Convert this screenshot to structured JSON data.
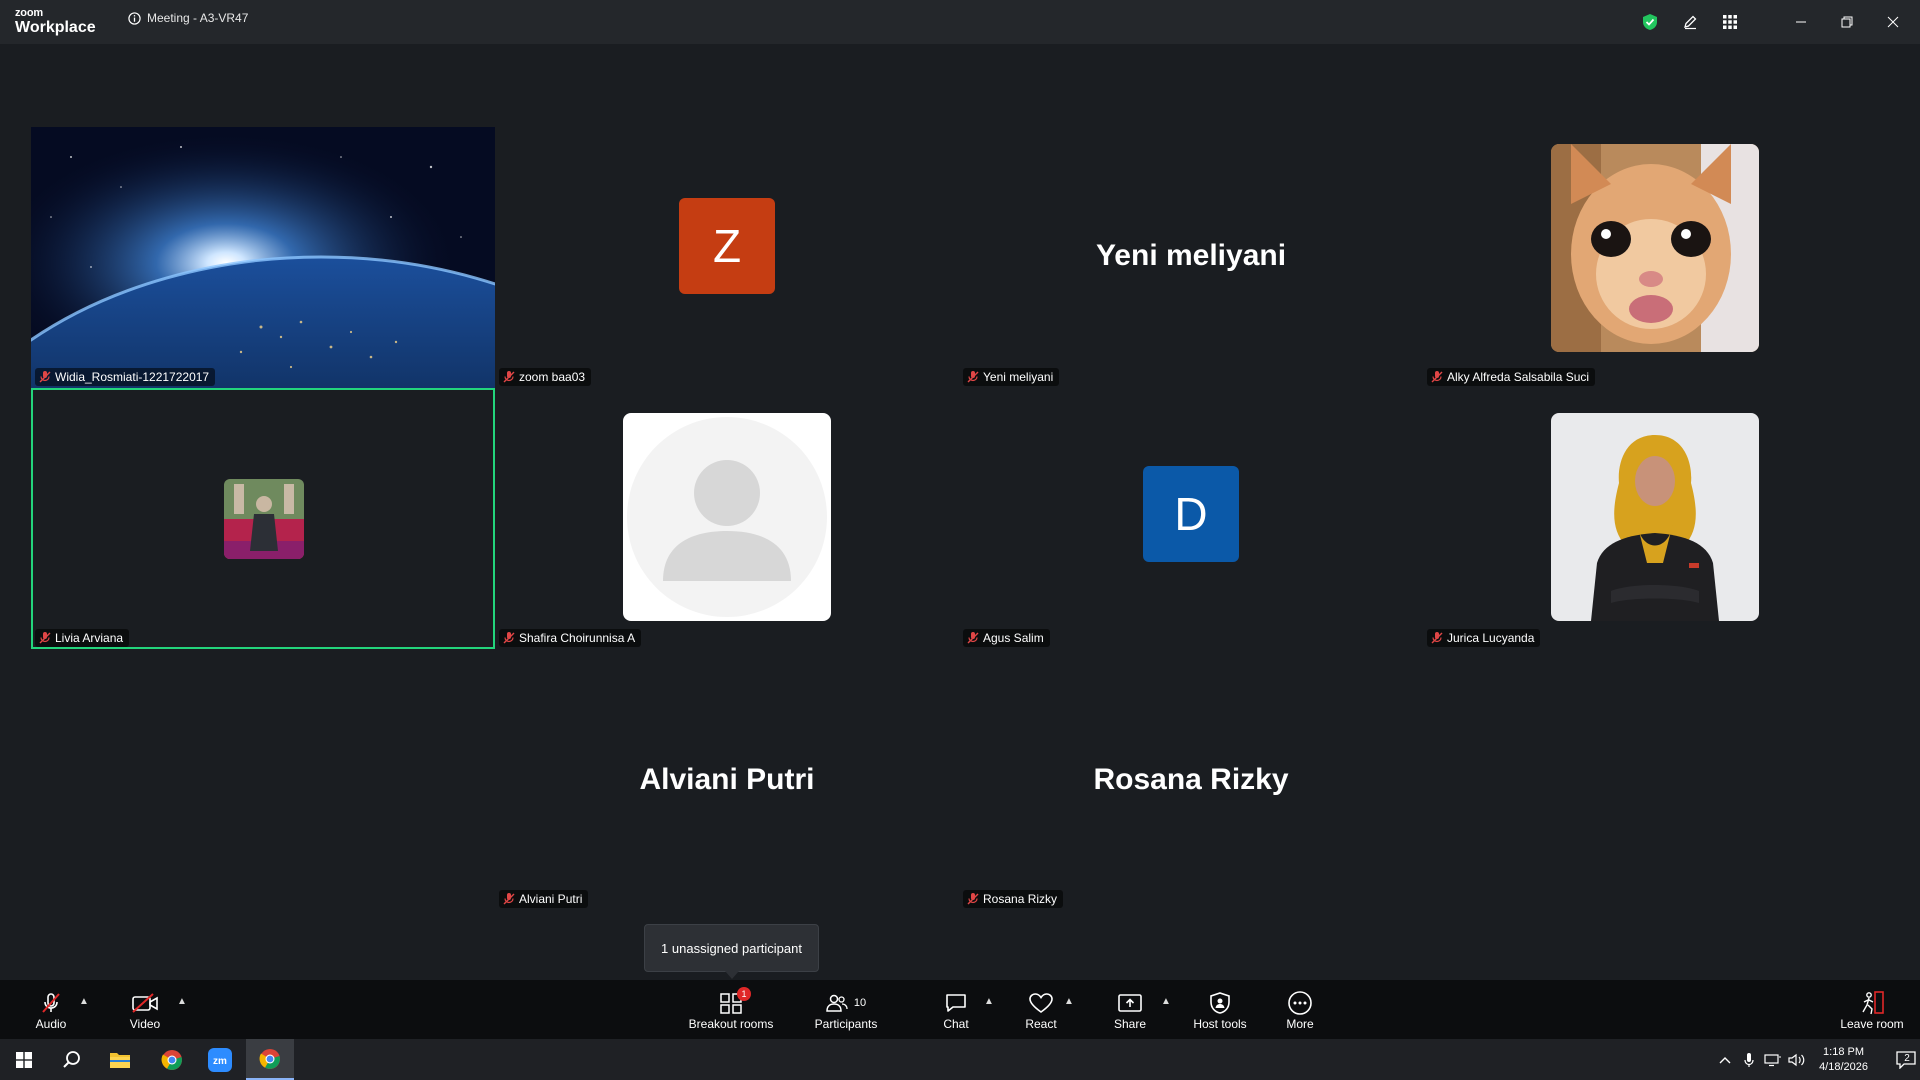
{
  "titlebar": {
    "brand_top": "zoom",
    "brand_bottom": "Workplace",
    "meeting_title": "Meeting - A3-VR47"
  },
  "tiles": [
    {
      "name": "Widia_Rosmiati-1221722017",
      "display": "video-earth"
    },
    {
      "name": "zoom baa03",
      "display": "initial",
      "initial": "Z",
      "color": "#c53d12"
    },
    {
      "name": "Yeni meliyani",
      "display": "text",
      "big_name": "Yeni meliyani"
    },
    {
      "name": "Alky Alfreda Salsabila Suci",
      "display": "photo-cat"
    },
    {
      "name": "Livia Arviana",
      "display": "small-photo",
      "active": true
    },
    {
      "name": "Shafira Choirunnisa A",
      "display": "default-avatar"
    },
    {
      "name": "Agus Salim",
      "display": "initial",
      "initial": "D",
      "color": "#0b59a8"
    },
    {
      "name": "Jurica Lucyanda",
      "display": "photo-person"
    },
    {
      "name": "Alviani Putri",
      "display": "text",
      "big_name": "Alviani Putri"
    },
    {
      "name": "Rosana Rizky",
      "display": "text",
      "big_name": "Rosana Rizky"
    }
  ],
  "tooltip": "1 unassigned participant",
  "toolbar": {
    "audio": "Audio",
    "video": "Video",
    "breakout": "Breakout rooms",
    "breakout_badge": "1",
    "participants": "Participants",
    "participants_count": "10",
    "chat": "Chat",
    "react": "React",
    "share": "Share",
    "host_tools": "Host tools",
    "more": "More",
    "leave": "Leave room"
  },
  "taskbar": {
    "time": "1:18 PM",
    "date": "4/18/2026",
    "notifications": "2"
  },
  "colors": {
    "accent_green": "#23d57c",
    "security_green": "#22c55e",
    "badge_red": "#e02828"
  }
}
